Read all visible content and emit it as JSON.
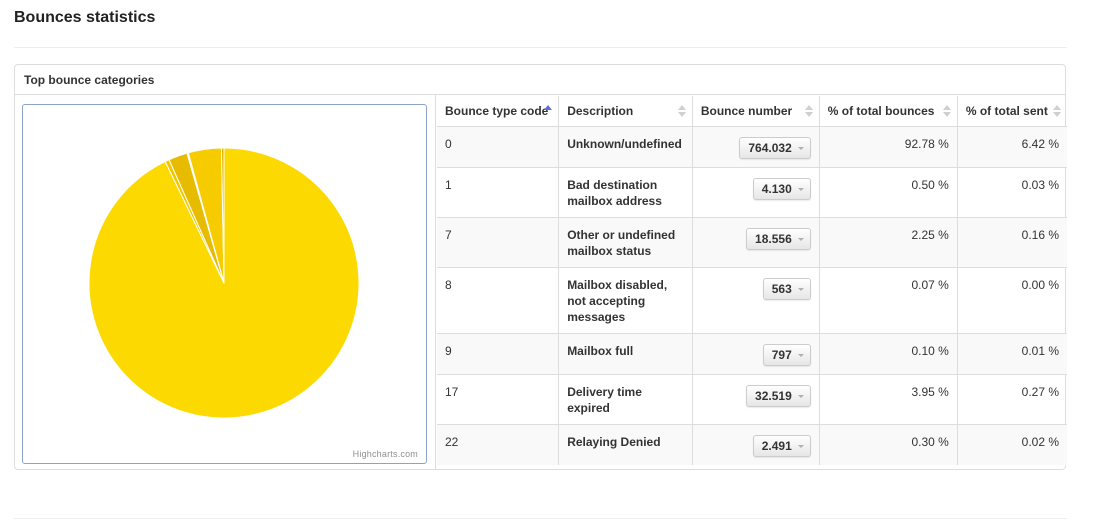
{
  "page": {
    "title": "Bounces statistics"
  },
  "panel": {
    "title": "Top bounce categories"
  },
  "chart_data": {
    "type": "pie",
    "title": "",
    "credits": "Highcharts.com",
    "categories": [
      "0",
      "1",
      "7",
      "8",
      "9",
      "17",
      "22"
    ],
    "labels": [
      "Unknown/undefined",
      "Bad destination mailbox address",
      "Other or undefined mailbox status",
      "Mailbox disabled, not accepting messages",
      "Mailbox full",
      "Delivery time expired",
      "Relaying Denied"
    ],
    "values": [
      764032,
      4130,
      18556,
      563,
      797,
      32519,
      2491
    ],
    "colors": [
      "#fcd900",
      "#f3c700",
      "#e6bb00",
      "#d9b000",
      "#cca500",
      "#f6cc00",
      "#e0b400"
    ],
    "legend": "none"
  },
  "table": {
    "columns": [
      {
        "label": "Bounce type code",
        "sort": "asc"
      },
      {
        "label": "Description",
        "sort": "none"
      },
      {
        "label": "Bounce number",
        "sort": "none"
      },
      {
        "label": "% of total bounces",
        "sort": "none"
      },
      {
        "label": "% of total sent",
        "sort": "none"
      }
    ],
    "rows": [
      {
        "code": "0",
        "description": "Unknown/undefined",
        "bounces": "764.032",
        "pct_bounces": "92.78 %",
        "pct_sent": "6.42 %"
      },
      {
        "code": "1",
        "description": "Bad destination mailbox address",
        "bounces": "4.130",
        "pct_bounces": "0.50 %",
        "pct_sent": "0.03 %"
      },
      {
        "code": "7",
        "description": "Other or undefined mailbox status",
        "bounces": "18.556",
        "pct_bounces": "2.25 %",
        "pct_sent": "0.16 %"
      },
      {
        "code": "8",
        "description": "Mailbox disabled, not accepting messages",
        "bounces": "563",
        "pct_bounces": "0.07 %",
        "pct_sent": "0.00 %"
      },
      {
        "code": "9",
        "description": "Mailbox full",
        "bounces": "797",
        "pct_bounces": "0.10 %",
        "pct_sent": "0.01 %"
      },
      {
        "code": "17",
        "description": "Delivery time expired",
        "bounces": "32.519",
        "pct_bounces": "3.95 %",
        "pct_sent": "0.27 %"
      },
      {
        "code": "22",
        "description": "Relaying Denied",
        "bounces": "2.491",
        "pct_bounces": "0.30 %",
        "pct_sent": "0.02 %"
      }
    ]
  },
  "colors": {
    "border": "#dddddd",
    "stripe": "#f9f9f9",
    "chart_border": "#8ba4c6",
    "sort_active": "#5a6fd6",
    "sort_inactive": "#d0d0d0"
  }
}
